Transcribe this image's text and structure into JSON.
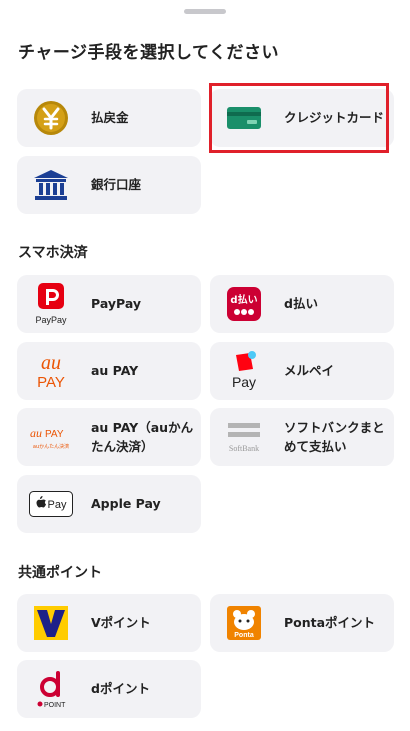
{
  "title": "チャージ手段を選択してください",
  "general_methods": [
    {
      "label": "払戻金",
      "icon": "yen-coin-icon"
    },
    {
      "label": "クレジットカード",
      "icon": "credit-card-icon"
    },
    {
      "label": "銀行口座",
      "icon": "bank-icon"
    }
  ],
  "smartphone_section": {
    "label": "スマホ決済",
    "items": [
      {
        "label": "PayPay",
        "icon": "paypay-logo"
      },
      {
        "label": "d払い",
        "icon": "d-barai-logo"
      },
      {
        "label": "au PAY",
        "icon": "au-pay-logo"
      },
      {
        "label": "メルペイ",
        "icon": "merpay-logo"
      },
      {
        "label": "au PAY（auかんたん決済）",
        "icon": "au-kantan-logo"
      },
      {
        "label": "ソフトバンクまとめて支払い",
        "icon": "softbank-logo"
      },
      {
        "label": "Apple Pay",
        "icon": "apple-pay-logo"
      }
    ]
  },
  "points_section": {
    "label": "共通ポイント",
    "items": [
      {
        "label": "Vポイント",
        "icon": "v-point-logo"
      },
      {
        "label": "Pontaポイント",
        "icon": "ponta-logo"
      },
      {
        "label": "dポイント",
        "icon": "d-point-logo"
      }
    ]
  },
  "logo_text": {
    "paypay": "PayPay",
    "dbarai": "d払い",
    "au": "au",
    "pay": "PAY",
    "au_kantan": "auかんたん決済",
    "merpay": "Pay",
    "softbank": "SoftBank",
    "applepay": "Pay",
    "v": "V",
    "ponta": "Ponta",
    "dpoint": "POINT"
  },
  "colors": {
    "highlight": "#e0202a",
    "card_bg": "#f2f2f5",
    "paypay_red": "#e60012",
    "docomo_red": "#cc0033",
    "au_orange": "#eb5505",
    "merpay_red": "#ff0211",
    "softbank_gray": "#b4b4b4",
    "vpoint_yellow": "#ffcc00",
    "vpoint_navy": "#1d2088",
    "ponta_orange": "#f08300",
    "credit_card_green": "#1a8f6a",
    "yen_gold": "#c8960c",
    "bank_blue": "#1c3f94"
  }
}
